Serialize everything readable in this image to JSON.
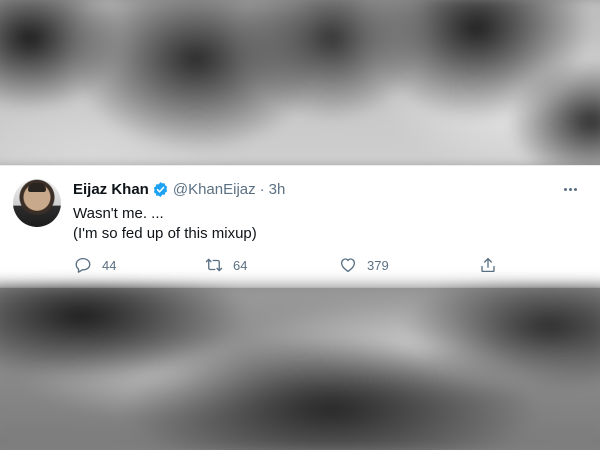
{
  "tweet": {
    "author_name": "Eijaz Khan",
    "handle": "@KhanEijaz",
    "separator": "·",
    "time": "3h",
    "text_lines": [
      "Wasn't me. ...",
      "(I'm so fed up of this mixup)"
    ],
    "verified": true,
    "actions": {
      "reply_count": "44",
      "retweet_count": "64",
      "like_count": "379"
    }
  },
  "colors": {
    "text_primary": "#0f1419",
    "text_secondary": "#5b7083",
    "verified_badge": "#1da1f2",
    "background": "#ffffff"
  },
  "icons": [
    "verified-badge-icon",
    "more-options-icon",
    "reply-icon",
    "retweet-icon",
    "like-icon",
    "share-icon"
  ]
}
